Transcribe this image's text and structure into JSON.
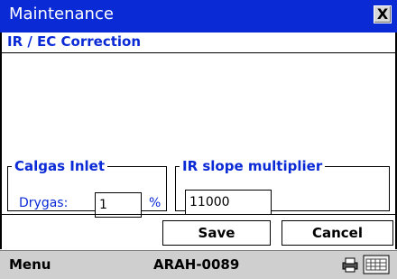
{
  "window": {
    "title": "Maintenance",
    "close_label": "X",
    "subtitle": "IR / EC Correction"
  },
  "calgas_inlet": {
    "legend": "Calgas Inlet",
    "drygas_label": "Drygas:",
    "drygas_value": "1",
    "unit": "%"
  },
  "ir_slope": {
    "legend": "IR slope multiplier",
    "value": "11000"
  },
  "buttons": {
    "save": "Save",
    "cancel": "Cancel"
  },
  "taskbar": {
    "menu": "Menu",
    "device_id": "ARAH-0089",
    "printer_icon": "printer-icon",
    "keyboard_icon": "keyboard-icon"
  },
  "colors": {
    "title_bar": "#0a2ad6",
    "accent_text": "#0a2ad6",
    "taskbar": "#cfcfcf"
  }
}
